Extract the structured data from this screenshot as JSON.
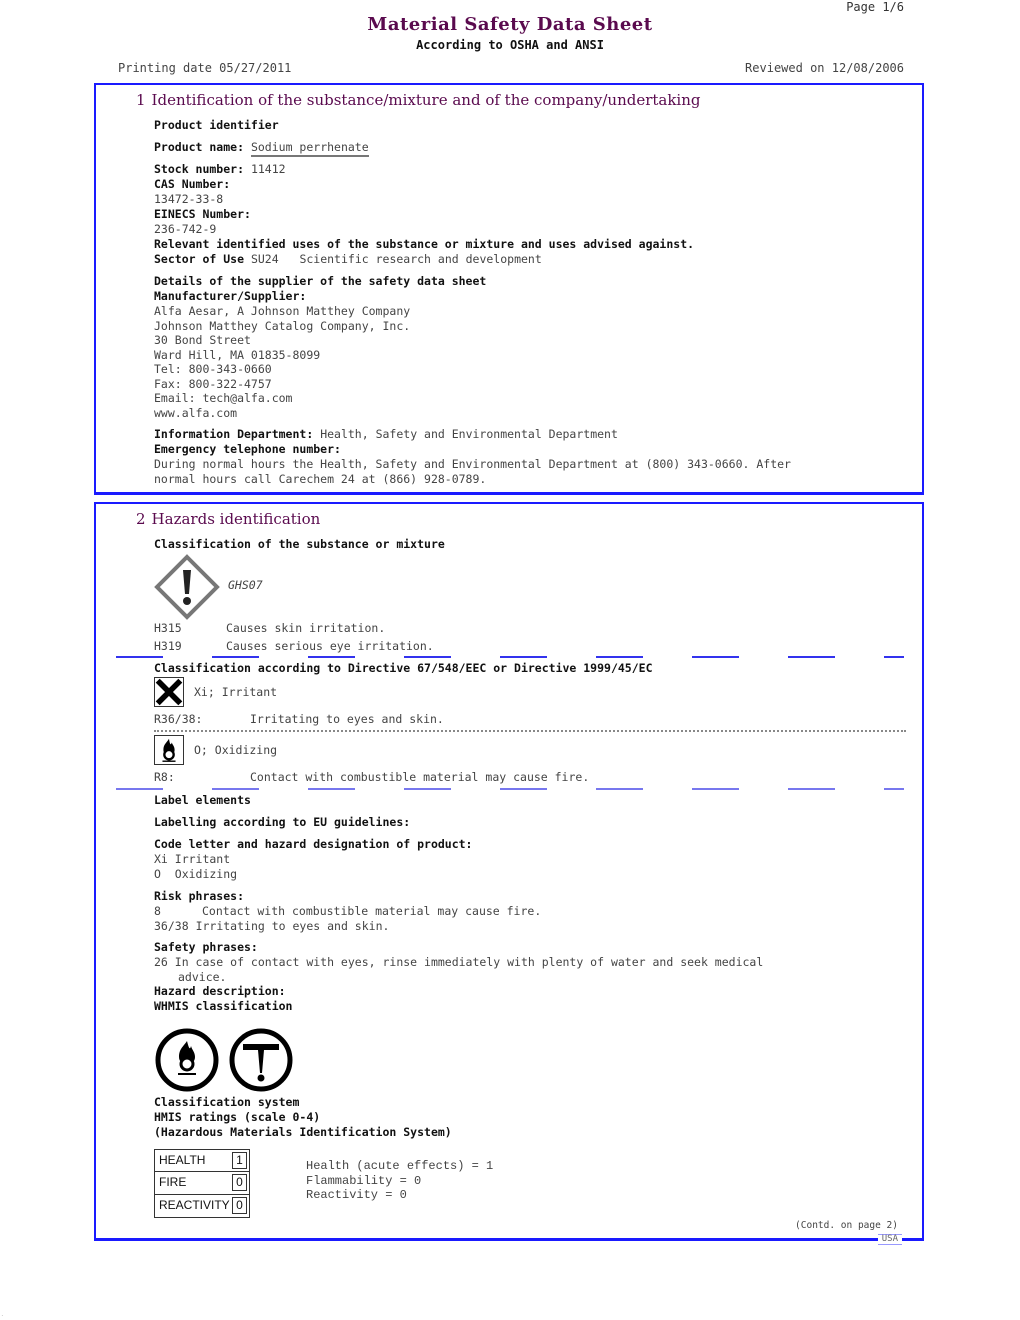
{
  "header": {
    "page": "Page 1/6",
    "title": "Material Safety Data Sheet",
    "subtitle": "According to OSHA and ANSI",
    "printing_date": "Printing date 05/27/2011",
    "reviewed": "Reviewed on 12/08/2006"
  },
  "section1": {
    "number": "1",
    "title": "Identification of the substance/mixture and of the company/undertaking",
    "product_identifier": "Product identifier",
    "product_name_label": "Product name:",
    "product_name": "Sodium perrhenate",
    "stock_label": "Stock number:",
    "stock": "11412",
    "cas_label": "CAS Number:",
    "cas": "13472-33-8",
    "einecs_label": "EINECS Number:",
    "einecs": "236-742-9",
    "uses_heading": "Relevant identified uses of the substance or mixture and uses advised against.",
    "sector_label": "Sector of Use",
    "sector_code": "SU24",
    "sector_desc": "Scientific research and development",
    "supplier_heading": "Details of the supplier of the safety data sheet",
    "manufacturer_label": "Manufacturer/Supplier:",
    "address": [
      "Alfa Aesar, A Johnson Matthey Company",
      "Johnson Matthey Catalog Company, Inc.",
      "30 Bond Street",
      "Ward Hill, MA 01835-8099",
      "Tel: 800-343-0660",
      "Fax: 800-322-4757",
      "Email: tech@alfa.com",
      "www.alfa.com"
    ],
    "info_dept_label": "Information Department:",
    "info_dept": "Health, Safety and Environmental Department",
    "emergency_label": "Emergency telephone number:",
    "emergency_line1": "During normal hours the Health, Safety and Environmental Department at (800) 343-0660.  After",
    "emergency_line2": "normal hours call Carechem 24 at (866) 928-0789."
  },
  "section2": {
    "number": "2",
    "title": "Hazards identification",
    "classification_heading": "Classification of the substance or mixture",
    "ghs_icon": "exclamation-diamond-icon",
    "ghs_code": "GHS07",
    "h_statements": [
      {
        "code": "H315",
        "text": "Causes skin irritation."
      },
      {
        "code": "H319",
        "text": "Causes serious eye irritation."
      }
    ],
    "directive_heading": "Classification according to Directive 67/548/EEC or Directive 1999/45/EC",
    "eu_classes": [
      {
        "icon": "irritant-x-icon",
        "label": "Xi; Irritant",
        "r_code": "R36/38:",
        "r_text": "Irritating to eyes and skin."
      },
      {
        "icon": "oxidizing-flame-icon",
        "label": "O; Oxidizing",
        "r_code": "R8:",
        "r_text": "Contact with combustible material may cause fire."
      }
    ],
    "label_elements": "Label elements",
    "labelling_eu": "Labelling according to EU guidelines:",
    "code_letter_heading": "Code letter and hazard designation of product:",
    "code_letters": [
      "Xi Irritant",
      "O  Oxidizing"
    ],
    "risk_heading": "Risk phrases:",
    "risk_phrases": [
      {
        "code": "8",
        "text": "Contact with combustible material may cause fire."
      },
      {
        "code": "36/38",
        "text": "Irritating to eyes and skin."
      }
    ],
    "safety_heading": "Safety phrases:",
    "safety_line1": "26 In case of contact with eyes, rinse immediately with plenty of water and seek medical",
    "safety_line2": "advice.",
    "hazard_desc": "Hazard description:",
    "whmis_heading": "WHMIS classification",
    "whmis_icons": [
      "whmis-oxidizing-icon",
      "whmis-toxic-icon"
    ],
    "classification_system": "Classification system",
    "hmis_heading": "HMIS ratings (scale 0-4)",
    "hmis_subheading": "(Hazardous Materials Identification System)",
    "hmis_table": [
      {
        "label": "HEALTH",
        "value": "1"
      },
      {
        "label": "FIRE",
        "value": "0"
      },
      {
        "label": "REACTIVITY",
        "value": "0"
      }
    ],
    "hmis_text": [
      "Health (acute effects) = 1",
      "Flammability = 0",
      "Reactivity = 0"
    ]
  },
  "footer": {
    "contd": "(Contd. on page 2)",
    "region": "USA",
    "corner_mark": "."
  },
  "colors": {
    "border": "#1a1aff",
    "heading": "#5a0a4e",
    "dash": "#3333ee"
  }
}
